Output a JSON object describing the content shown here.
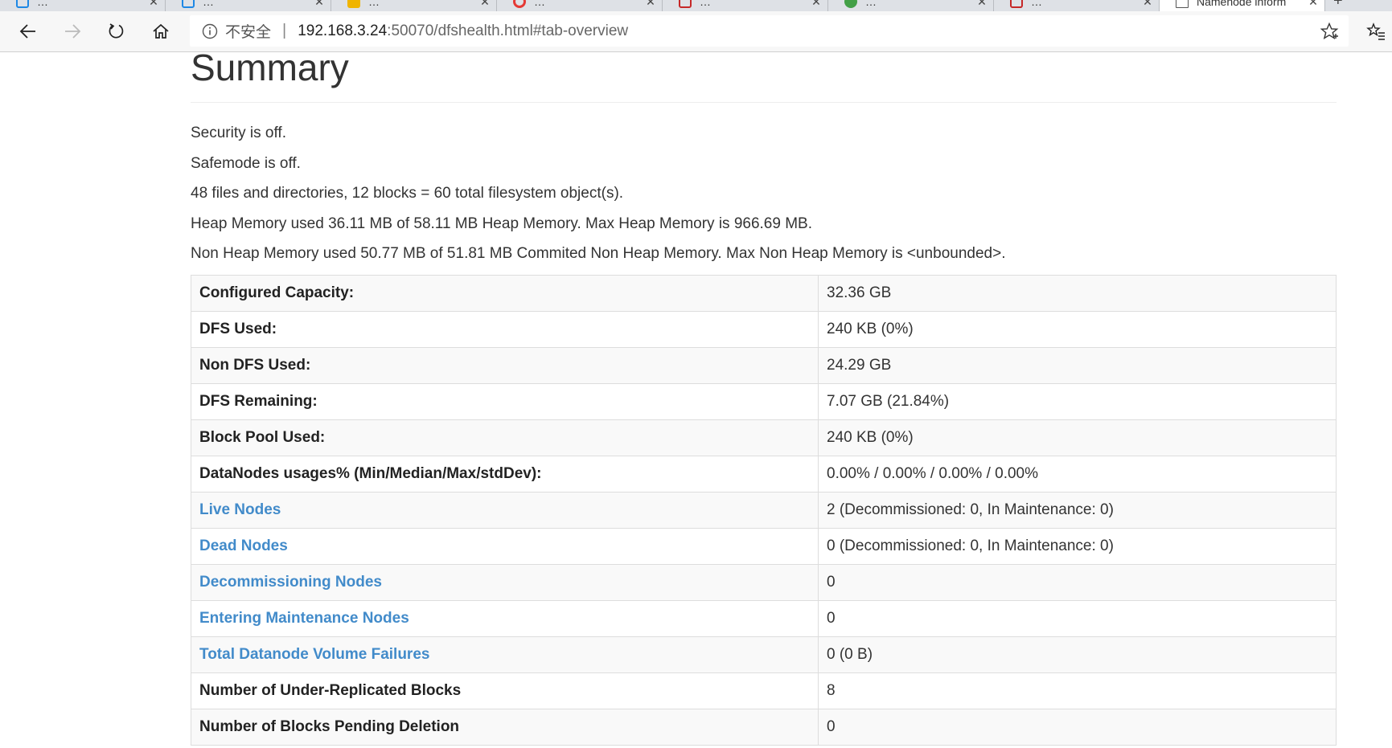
{
  "browser": {
    "tabs": [
      {
        "title": "…",
        "favicon_color": "#1e88e5"
      },
      {
        "title": "…",
        "favicon_color": "#1e88e5"
      },
      {
        "title": "…",
        "favicon_color": "#f0b400"
      },
      {
        "title": "…",
        "favicon_color": "#e53935"
      },
      {
        "title": "…",
        "favicon_color": "#c62828"
      },
      {
        "title": "…",
        "favicon_color": "#43a047"
      },
      {
        "title": "…",
        "favicon_color": "#c62828"
      },
      {
        "title": "Namenode inform",
        "favicon_color": "#ffffff",
        "active": true
      }
    ],
    "close_glyph": "✕",
    "newtab_glyph": "+",
    "address": {
      "security_label": "不安全",
      "separator": "|",
      "url_host": "192.168.3.24",
      "url_rest": ":50070/dfshealth.html#tab-overview"
    },
    "icons": {
      "back": "back-arrow-icon",
      "forward": "forward-arrow-icon",
      "refresh": "refresh-icon",
      "home": "home-icon",
      "info": "info-circle-icon",
      "star": "star-outline-icon",
      "favorites": "favorites-star-list-icon"
    }
  },
  "summary": {
    "title": "Summary",
    "lines": [
      "Security is off.",
      "Safemode is off.",
      "48 files and directories, 12 blocks = 60 total filesystem object(s).",
      "Heap Memory used 36.11 MB of 58.11 MB Heap Memory. Max Heap Memory is 966.69 MB.",
      "Non Heap Memory used 50.77 MB of 51.81 MB Commited Non Heap Memory. Max Non Heap Memory is <unbounded>."
    ],
    "rows": [
      {
        "label": "Configured Capacity:",
        "value": "32.36 GB",
        "link": false
      },
      {
        "label": "DFS Used:",
        "value": "240 KB (0%)",
        "link": false
      },
      {
        "label": "Non DFS Used:",
        "value": "24.29 GB",
        "link": false
      },
      {
        "label": "DFS Remaining:",
        "value": "7.07 GB (21.84%)",
        "link": false
      },
      {
        "label": "Block Pool Used:",
        "value": "240 KB (0%)",
        "link": false
      },
      {
        "label": "DataNodes usages% (Min/Median/Max/stdDev):",
        "value": "0.00% / 0.00% / 0.00% / 0.00%",
        "link": false
      },
      {
        "label": "Live Nodes",
        "value": "2 (Decommissioned: 0, In Maintenance: 0)",
        "link": true
      },
      {
        "label": "Dead Nodes",
        "value": "0 (Decommissioned: 0, In Maintenance: 0)",
        "link": true
      },
      {
        "label": "Decommissioning Nodes",
        "value": "0",
        "link": true
      },
      {
        "label": "Entering Maintenance Nodes",
        "value": "0",
        "link": true
      },
      {
        "label": "Total Datanode Volume Failures",
        "value": "0 (0 B)",
        "link": true
      },
      {
        "label": "Number of Under-Replicated Blocks",
        "value": "8",
        "link": false
      },
      {
        "label": "Number of Blocks Pending Deletion",
        "value": "0",
        "link": false
      }
    ]
  },
  "colors": {
    "link": "#428bca",
    "text": "#333333",
    "row_stripe": "#f9f9f9",
    "border": "#dddddd"
  }
}
